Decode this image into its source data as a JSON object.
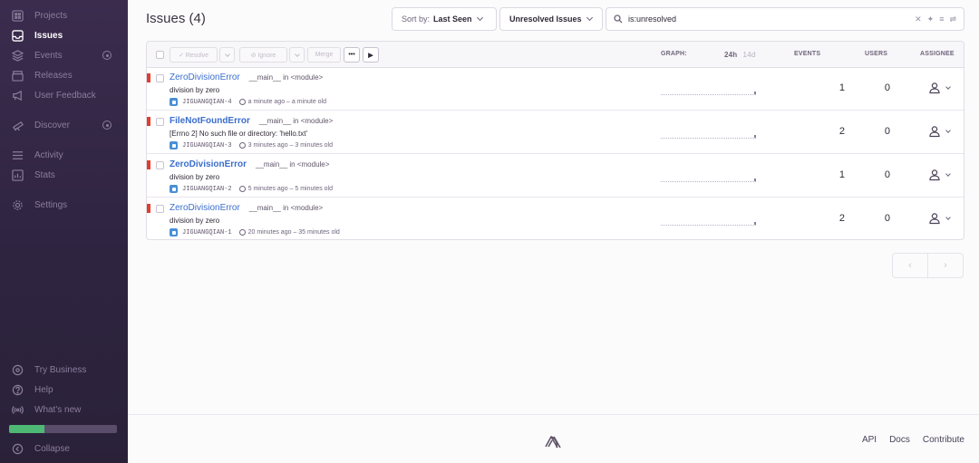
{
  "sidebar": {
    "items": [
      {
        "label": "Projects",
        "icon": "grid-icon"
      },
      {
        "label": "Issues",
        "icon": "inbox-icon",
        "active": true
      },
      {
        "label": "Events",
        "icon": "layers-icon"
      },
      {
        "label": "Releases",
        "icon": "package-icon"
      },
      {
        "label": "User Feedback",
        "icon": "megaphone-icon"
      },
      {
        "label": "Discover",
        "icon": "telescope-icon"
      },
      {
        "label": "Activity",
        "icon": "list-icon"
      },
      {
        "label": "Stats",
        "icon": "chart-icon"
      },
      {
        "label": "Settings",
        "icon": "gear-icon"
      }
    ],
    "bottom": {
      "try_business": "Try Business",
      "help": "Help",
      "whats_new": "What's new",
      "collapse": "Collapse"
    },
    "progress_fraction": 0.33
  },
  "header": {
    "title": "Issues (4)",
    "sort_prefix": "Sort by:",
    "sort_value": "Last Seen",
    "filter_value": "Unresolved Issues",
    "search_value": "is:unresolved"
  },
  "toolbar": {
    "resolve": "✓ Resolve",
    "ignore": "⊘ Ignore",
    "merge": "Merge",
    "more": "•••",
    "play": "▶"
  },
  "columns": {
    "graph": "GRAPH:",
    "period_24h": "24h",
    "period_14d": "14d",
    "events": "EVENTS",
    "users": "USERS",
    "assignee": "ASSIGNEE"
  },
  "issues": [
    {
      "title": "ZeroDivisionError",
      "location": "__main__ in <module>",
      "message": "division by zero",
      "short_id": "JIGUANGQIAN-4",
      "time": "a minute ago – a minute old",
      "events": "1",
      "users": "0",
      "bold": false
    },
    {
      "title": "FileNotFoundError",
      "location": "__main__ in <module>",
      "message": "[Errno 2] No such file or directory: 'hello.txt'",
      "short_id": "JIGUANGQIAN-3",
      "time": "3 minutes ago – 3 minutes old",
      "events": "2",
      "users": "0",
      "bold": true
    },
    {
      "title": "ZeroDivisionError",
      "location": "__main__ in <module>",
      "message": "division by zero",
      "short_id": "JIGUANGQIAN-2",
      "time": "5 minutes ago – 5 minutes old",
      "events": "1",
      "users": "0",
      "bold": true
    },
    {
      "title": "ZeroDivisionError",
      "location": "__main__ in <module>",
      "message": "division by zero",
      "short_id": "JIGUANGQIAN-1",
      "time": "20 minutes ago – 35 minutes old",
      "events": "2",
      "users": "0",
      "bold": false
    }
  ],
  "pagination": {
    "prev": "‹",
    "next": "›"
  },
  "footer": {
    "links": [
      "API",
      "Docs",
      "Contribute"
    ]
  },
  "colors": {
    "sidebar": "#2e2440",
    "level_error": "#e03e2f",
    "link": "#3b6ecc",
    "progress": "#4eb875"
  }
}
